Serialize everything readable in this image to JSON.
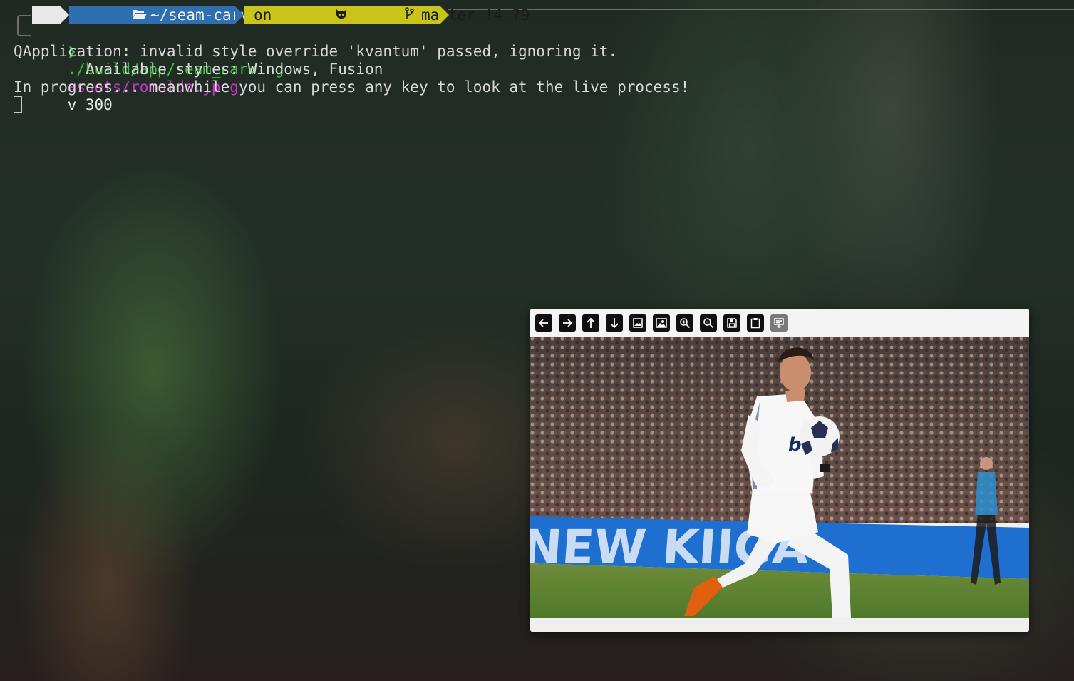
{
  "terminal": {
    "prompt": {
      "os_icon": "linux-tux-icon",
      "folder_icon": "folder-open-icon",
      "directory": "~/seam-carving",
      "git_prefix": "on",
      "github_icon": "github-octocat-icon",
      "branch_icon": "git-branch-icon",
      "branch": "master",
      "status": "!4 ?9",
      "prompt_char": "❯",
      "colors": {
        "os_segment": "#e8e8e8",
        "dir_segment": "#2f6fb0",
        "git_segment": "#c8c41a"
      }
    },
    "command": {
      "executable": "./build/app/seam_carving",
      "argument_path": "assets/ronaldo.jpeg",
      "rest_args": "v 300"
    },
    "output": [
      "QApplication: invalid style override 'kvantum' passed, ignoring it.",
      "        Available styles: Windows, Fusion",
      "In progress... meanwhile you can press any key to look at the live process!"
    ]
  },
  "viewer": {
    "toolbar": [
      {
        "name": "back-arrow-icon",
        "action": "previous"
      },
      {
        "name": "forward-arrow-icon",
        "action": "next"
      },
      {
        "name": "up-arrow-icon",
        "action": "up"
      },
      {
        "name": "down-arrow-icon",
        "action": "down"
      },
      {
        "name": "image-icon",
        "action": "original image"
      },
      {
        "name": "image-portrait-icon",
        "action": "carved image"
      },
      {
        "name": "zoom-in-icon",
        "action": "zoom in"
      },
      {
        "name": "zoom-out-icon",
        "action": "zoom out"
      },
      {
        "name": "save-icon",
        "action": "save"
      },
      {
        "name": "clipboard-icon",
        "action": "copy"
      },
      {
        "name": "properties-icon",
        "action": "properties"
      }
    ],
    "image": {
      "description_icon": "photo-footballer",
      "banner_text": "NEW KIIGA"
    }
  }
}
